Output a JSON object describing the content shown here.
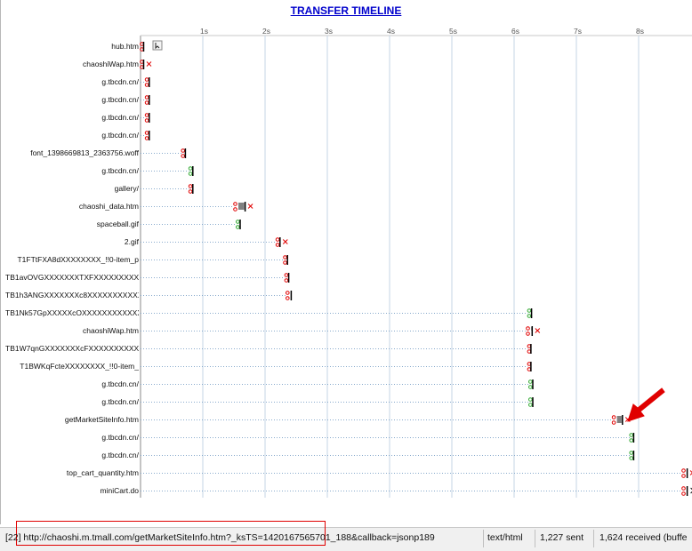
{
  "title": "TRANSFER TIMELINE",
  "ticks": [
    {
      "label": "1s",
      "t": 1
    },
    {
      "label": "2s",
      "t": 2
    },
    {
      "label": "3s",
      "t": 3
    },
    {
      "label": "4s",
      "t": 4
    },
    {
      "label": "5s",
      "t": 5
    },
    {
      "label": "6s",
      "t": 6
    },
    {
      "label": "7s",
      "t": 7
    },
    {
      "label": "8s",
      "t": 8
    }
  ],
  "rows": [
    {
      "name": "hub.htm",
      "start": 0.0,
      "red": true,
      "green": false,
      "end": 0.05,
      "thick": 1,
      "cross": false,
      "extra": "hub"
    },
    {
      "name": "chaoshiWap.htm",
      "start": 0.0,
      "red": true,
      "green": false,
      "end": 0.05,
      "thick": 1,
      "cross": true
    },
    {
      "name": "g.tbcdn.cn/",
      "start": 0.08,
      "red": true,
      "green": false,
      "end": 0.14,
      "thick": 1,
      "cross": false
    },
    {
      "name": "g.tbcdn.cn/",
      "start": 0.08,
      "red": true,
      "green": false,
      "end": 0.14,
      "thick": 1,
      "cross": false
    },
    {
      "name": "g.tbcdn.cn/",
      "start": 0.08,
      "red": true,
      "green": false,
      "end": 0.14,
      "thick": 1,
      "cross": false
    },
    {
      "name": "g.tbcdn.cn/",
      "start": 0.08,
      "red": true,
      "green": false,
      "end": 0.14,
      "thick": 1,
      "cross": false
    },
    {
      "name": "font_1398669813_2363756.woff",
      "start": 0.66,
      "red": true,
      "green": false,
      "end": 0.72,
      "thick": 1,
      "cross": false
    },
    {
      "name": "g.tbcdn.cn/",
      "start": 0.78,
      "red": false,
      "green": true,
      "end": 0.84,
      "thick": 1,
      "cross": false
    },
    {
      "name": "gallery/",
      "start": 0.78,
      "red": true,
      "green": false,
      "end": 0.84,
      "thick": 1,
      "cross": false
    },
    {
      "name": "chaoshi_data.htm",
      "start": 1.5,
      "red": true,
      "green": false,
      "end": 1.68,
      "thick": 4,
      "cross": true
    },
    {
      "name": "spaceball.gif",
      "start": 1.54,
      "red": false,
      "green": true,
      "end": 1.6,
      "thick": 1,
      "cross": false
    },
    {
      "name": "2.gif",
      "start": 2.18,
      "red": true,
      "green": false,
      "end": 2.24,
      "thick": 1,
      "cross": true
    },
    {
      "name": "T1FTtFXA8dXXXXXXXX_!!0-item_p",
      "start": 2.3,
      "red": true,
      "green": false,
      "end": 2.36,
      "thick": 1,
      "cross": false
    },
    {
      "name": "TB1avOVGXXXXXXXTXFXXXXXXXXXX",
      "start": 2.32,
      "red": true,
      "green": false,
      "end": 2.38,
      "thick": 1,
      "cross": false
    },
    {
      "name": "TB1h3ANGXXXXXXXc8XXXXXXXXXXX",
      "start": 2.34,
      "red": true,
      "green": false,
      "end": 2.42,
      "thick": 1,
      "cross": false
    },
    {
      "name": "TB1Nk57GpXXXXXcOXXXXXXXXXXXX",
      "start": 6.22,
      "red": false,
      "green": true,
      "end": 6.28,
      "thick": 1,
      "cross": false
    },
    {
      "name": "chaoshiWap.htm",
      "start": 6.2,
      "red": true,
      "green": false,
      "end": 6.29,
      "thick": 2,
      "cross": true
    },
    {
      "name": "TB1W7qnGXXXXXXXcFXXXXXXXXXXX",
      "start": 6.22,
      "red": true,
      "green": false,
      "end": 6.27,
      "thick": 1,
      "cross": false
    },
    {
      "name": "T1BWKqFcteXXXXXXXX_!!0-item_",
      "start": 6.22,
      "red": true,
      "green": false,
      "end": 6.27,
      "thick": 1,
      "cross": false
    },
    {
      "name": "g.tbcdn.cn/",
      "start": 6.24,
      "red": false,
      "green": true,
      "end": 6.3,
      "thick": 1,
      "cross": false
    },
    {
      "name": "g.tbcdn.cn/",
      "start": 6.24,
      "red": false,
      "green": true,
      "end": 6.3,
      "thick": 1,
      "cross": false
    },
    {
      "name": "getMarketSiteInfo.htm",
      "start": 7.58,
      "red": true,
      "green": false,
      "end": 7.74,
      "thick": 4,
      "cross": true
    },
    {
      "name": "g.tbcdn.cn/",
      "start": 7.86,
      "red": false,
      "green": true,
      "end": 7.92,
      "thick": 1,
      "cross": false
    },
    {
      "name": "g.tbcdn.cn/",
      "start": 7.86,
      "red": false,
      "green": true,
      "end": 7.92,
      "thick": 1,
      "cross": false
    },
    {
      "name": "top_cart_quantity.htm",
      "start": 8.7,
      "red": true,
      "green": false,
      "end": 8.78,
      "thick": 1,
      "cross": true
    },
    {
      "name": "miniCart.do",
      "start": 8.7,
      "red": true,
      "green": false,
      "end": 8.78,
      "thick": 1,
      "cross": false,
      "more": true
    }
  ],
  "status": {
    "url": "[22] http://chaoshi.m.tmall.com/getMarketSiteInfo.htm?_ksTS=1420167565701_188&callback=jsonp189",
    "type": "text/html",
    "sent": "1,227 sent",
    "received": "1,624 received (buffe"
  },
  "colors": {
    "accent": "#0000cc",
    "red": "#e00000",
    "green": "#33aa33",
    "dots": "#88aacc",
    "highlight": "#e00000"
  }
}
